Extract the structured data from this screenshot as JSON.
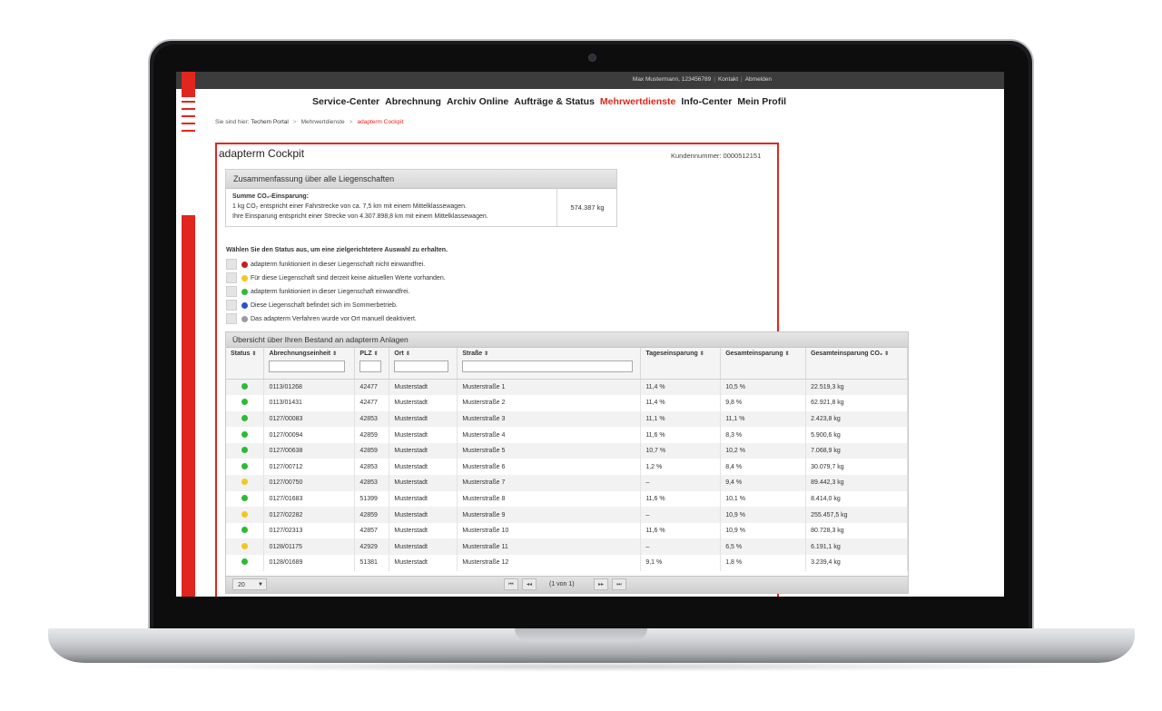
{
  "topbar": {
    "user": "Max Mustermann, 123456789",
    "contact": "Kontakt",
    "logout": "Abmelden"
  },
  "nav": [
    "Service-Center",
    "Abrechnung",
    "Archiv Online",
    "Aufträge & Status",
    "Mehrwertdienste",
    "Info-Center",
    "Mein Profil"
  ],
  "nav_active_index": 4,
  "breadcrumb": {
    "prefix": "Sie sind hier:",
    "items": [
      "Techem Portal",
      "Mehrwertdienste",
      "adapterm Cockpit"
    ],
    "separator": ">"
  },
  "page": {
    "title": "adapterm Cockpit",
    "customer_number": "Kundennummer: 0000512151"
  },
  "summary": {
    "header": "Zusammenfassung über alle Liegenschaften",
    "label": "Summe CO₂-Einsparung:",
    "line1": "1 kg CO₂ entspricht einer Fahrstrecke von ca. 7,5 km mit einem Mittelklassewagen.",
    "line2": "Ihre Einsparung entspricht einer Strecke von 4.307.898,8 km mit einem Mittelklassewagen.",
    "value": "574.387 kg"
  },
  "status_filter": {
    "heading": "Wählen Sie den Status aus, um eine zielgerichtetere Auswahl zu erhalten.",
    "items": [
      {
        "label": "adapterm funktioniert in dieser Liegenschaft nicht einwandfrei.",
        "color": "#c81e1e"
      },
      {
        "label": "Für diese Liegenschaft sind derzeit keine aktuellen Werte vorhanden.",
        "color": "#f2c81f"
      },
      {
        "label": "adapterm funktioniert in dieser Liegenschaft einwandfrei.",
        "color": "#2dbb34"
      },
      {
        "label": "Diese Liegenschaft befindet sich im Sommerbetrieb.",
        "color": "#2952c9"
      },
      {
        "label": "Das adapterm Verfahren wurde vor Ort manuell deaktiviert.",
        "color": "#9c9c9c"
      }
    ]
  },
  "table": {
    "header": "Übersicht über Ihren Bestand an adapterm Anlagen",
    "columns": [
      "Status",
      "Abrechnungseinheit",
      "PLZ",
      "Ort",
      "Straße",
      "Tageseinsparung",
      "Gesamteinsparung",
      "Gesamteinsparung CO₂"
    ],
    "rows": [
      {
        "status": "green",
        "unit": "0113/01268",
        "plz": "42477",
        "ort": "Musterstadt",
        "strasse": "Musterstraße 1",
        "tag": "11,4 %",
        "gesamt": "10,5 %",
        "co2": "22.519,3 kg"
      },
      {
        "status": "green",
        "unit": "0113/01431",
        "plz": "42477",
        "ort": "Musterstadt",
        "strasse": "Musterstraße 2",
        "tag": "11,4 %",
        "gesamt": "9,8 %",
        "co2": "62.921,8 kg"
      },
      {
        "status": "green",
        "unit": "0127/00083",
        "plz": "42853",
        "ort": "Musterstadt",
        "strasse": "Musterstraße 3",
        "tag": "11,1 %",
        "gesamt": "11,1 %",
        "co2": "2.423,8 kg"
      },
      {
        "status": "green",
        "unit": "0127/00094",
        "plz": "42859",
        "ort": "Musterstadt",
        "strasse": "Musterstraße 4",
        "tag": "11,6 %",
        "gesamt": "8,3 %",
        "co2": "5.900,6 kg"
      },
      {
        "status": "green",
        "unit": "0127/00638",
        "plz": "42859",
        "ort": "Musterstadt",
        "strasse": "Musterstraße 5",
        "tag": "10,7 %",
        "gesamt": "10,2 %",
        "co2": "7.068,9 kg"
      },
      {
        "status": "green",
        "unit": "0127/00712",
        "plz": "42853",
        "ort": "Musterstadt",
        "strasse": "Musterstraße 6",
        "tag": "1,2 %",
        "gesamt": "8,4 %",
        "co2": "30.079,7 kg"
      },
      {
        "status": "yellow",
        "unit": "0127/00750",
        "plz": "42853",
        "ort": "Musterstadt",
        "strasse": "Musterstraße 7",
        "tag": "–",
        "gesamt": "9,4 %",
        "co2": "89.442,3 kg"
      },
      {
        "status": "green",
        "unit": "0127/01683",
        "plz": "51399",
        "ort": "Musterstadt",
        "strasse": "Musterstraße 8",
        "tag": "11,6 %",
        "gesamt": "10,1 %",
        "co2": "8.414,0 kg"
      },
      {
        "status": "yellow",
        "unit": "0127/02282",
        "plz": "42859",
        "ort": "Musterstadt",
        "strasse": "Musterstraße 9",
        "tag": "–",
        "gesamt": "10,9 %",
        "co2": "255.457,5 kg"
      },
      {
        "status": "green",
        "unit": "0127/02313",
        "plz": "42857",
        "ort": "Musterstadt",
        "strasse": "Musterstraße 10",
        "tag": "11,6 %",
        "gesamt": "10,9 %",
        "co2": "80.728,3 kg"
      },
      {
        "status": "yellow",
        "unit": "0128/01175",
        "plz": "42929",
        "ort": "Musterstadt",
        "strasse": "Musterstraße 11",
        "tag": "–",
        "gesamt": "6,5 %",
        "co2": "6.191,1 kg"
      },
      {
        "status": "green",
        "unit": "0128/01689",
        "plz": "51381",
        "ort": "Musterstadt",
        "strasse": "Musterstraße 12",
        "tag": "9,1 %",
        "gesamt": "1,8 %",
        "co2": "3.239,4 kg"
      }
    ],
    "status_colors": {
      "green": "#2dbb34",
      "yellow": "#f2c81f"
    }
  },
  "pager": {
    "page_size": "20",
    "info": "(1 von 1)",
    "first": "⏮",
    "prev": "◂◂",
    "next": "▸▸",
    "last": "⏭"
  },
  "icons": {
    "sort": "sort-icon",
    "dropdown": "chevron-down-icon"
  },
  "colors": {
    "accent": "#e0261e",
    "topbar": "#3c3c3c"
  }
}
